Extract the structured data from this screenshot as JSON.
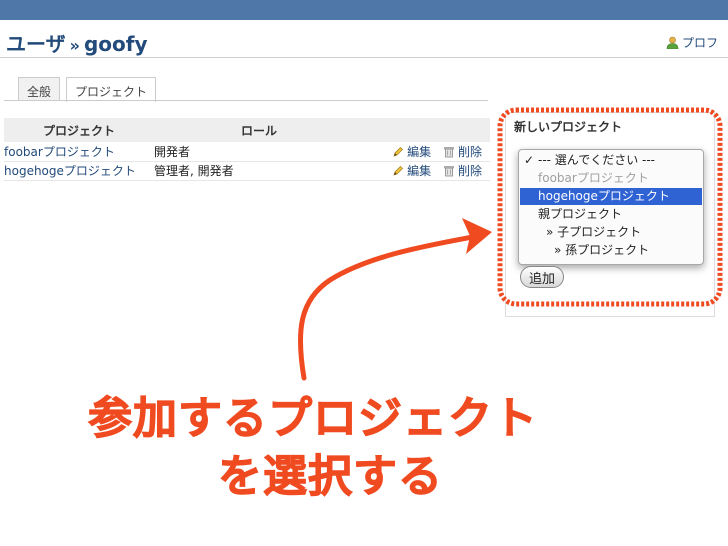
{
  "header": {
    "breadcrumb_parent": "ユーザ",
    "separator": "»",
    "user_name": "goofy",
    "profile_label": "プロフ"
  },
  "tabs": [
    {
      "label": "全般",
      "selected": false
    },
    {
      "label": "プロジェクト",
      "selected": true
    }
  ],
  "memberships": {
    "columns": [
      "プロジェクト",
      "ロール"
    ],
    "rows": [
      {
        "project": "foobarプロジェクト",
        "roles": "開発者",
        "edit": "編集",
        "delete": "削除"
      },
      {
        "project": "hogehogeプロジェクト",
        "roles": "管理者, 開発者",
        "edit": "編集",
        "delete": "削除"
      }
    ]
  },
  "new_project": {
    "title": "新しいプロジェクト",
    "options": [
      {
        "label": "--- 選んでください ---",
        "checked": true,
        "state": "normal"
      },
      {
        "label": "foobarプロジェクト",
        "checked": false,
        "state": "disabled"
      },
      {
        "label": "hogehogeプロジェクト",
        "checked": false,
        "state": "highlighted"
      },
      {
        "label": "親プロジェクト",
        "checked": false,
        "state": "normal"
      },
      {
        "label": "» 子プロジェクト",
        "checked": false,
        "state": "normal"
      },
      {
        "label": "» 孫プロジェクト",
        "checked": false,
        "state": "normal"
      }
    ],
    "add_button": "追加"
  },
  "annotation": {
    "line1": "参加するプロジェクト",
    "line2": "を選択する",
    "color": "#f04a20"
  },
  "colors": {
    "topbar": "#4f78a8",
    "link": "#224a7a",
    "highlight": "#2f63d4"
  }
}
